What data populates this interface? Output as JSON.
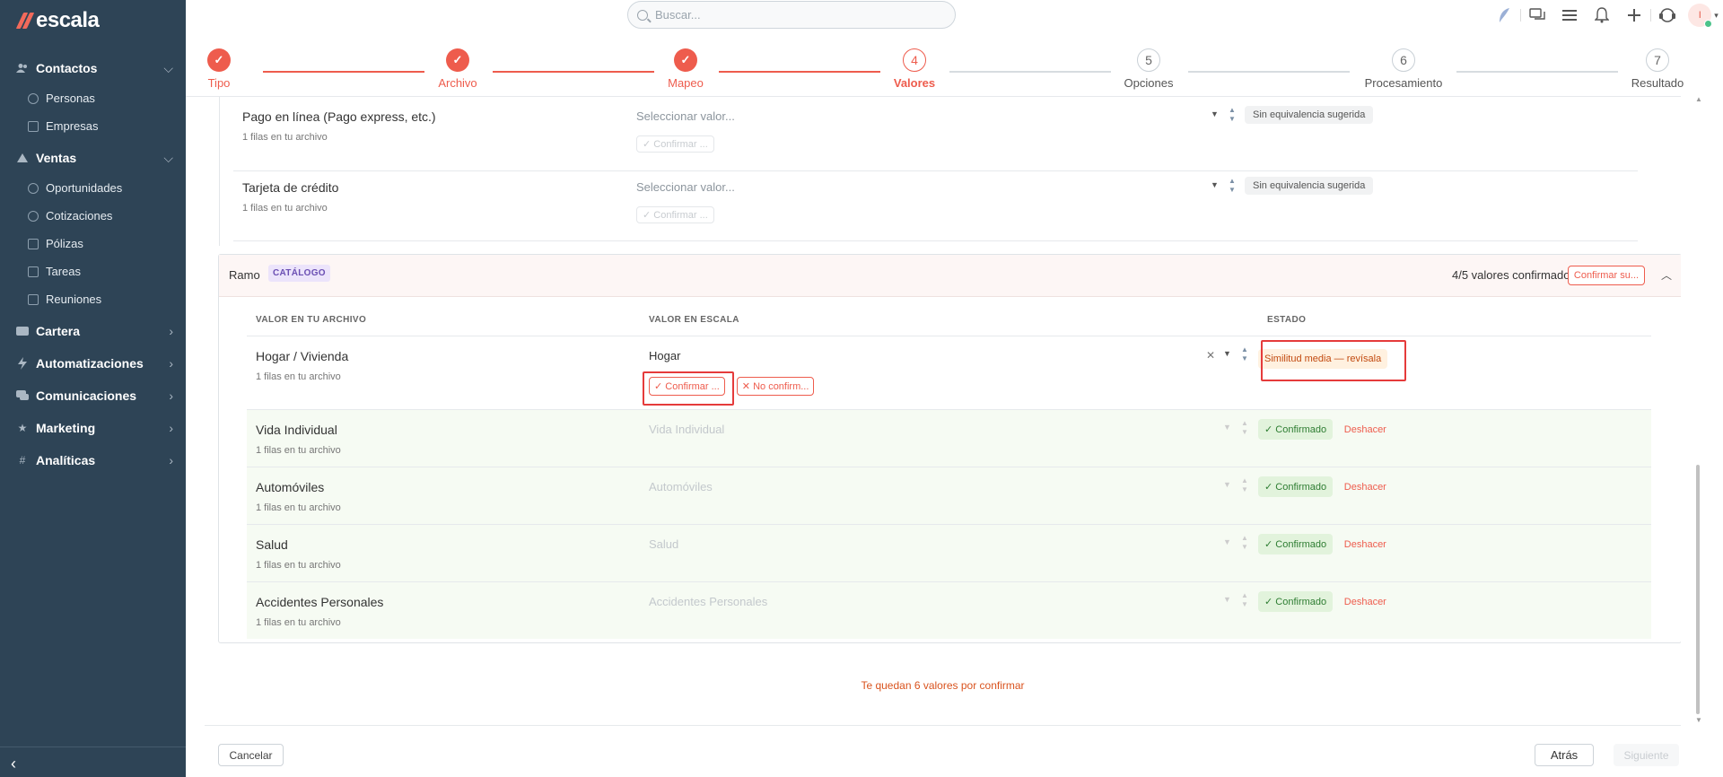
{
  "app": {
    "logo_text": "escala"
  },
  "sidebar": {
    "groups": [
      {
        "label": "Contactos",
        "icon": "users-icon",
        "expanded": true,
        "items": [
          "Personas",
          "Empresas"
        ]
      },
      {
        "label": "Ventas",
        "icon": "ventas-icon",
        "expanded": true,
        "items": [
          "Oportunidades",
          "Cotizaciones",
          "Pólizas",
          "Tareas",
          "Reuniones"
        ]
      },
      {
        "label": "Cartera",
        "icon": "wallet-icon",
        "expanded": false
      },
      {
        "label": "Automatizaciones",
        "icon": "bolt-icon",
        "expanded": false
      },
      {
        "label": "Comunicaciones",
        "icon": "chat-icon",
        "expanded": false
      },
      {
        "label": "Marketing",
        "icon": "star-icon",
        "expanded": false
      },
      {
        "label": "Analíticas",
        "icon": "hash-icon",
        "expanded": false
      }
    ]
  },
  "topbar": {
    "search_placeholder": "Buscar...",
    "avatar_initial": "I"
  },
  "stepper": {
    "steps": [
      {
        "num": "✓",
        "label": "Tipo",
        "state": "done"
      },
      {
        "num": "✓",
        "label": "Archivo",
        "state": "done"
      },
      {
        "num": "✓",
        "label": "Mapeo",
        "state": "done"
      },
      {
        "num": "4",
        "label": "Valores",
        "state": "active"
      },
      {
        "num": "5",
        "label": "Opciones",
        "state": "pending"
      },
      {
        "num": "6",
        "label": "Procesamiento",
        "state": "pending"
      },
      {
        "num": "7",
        "label": "Resultado",
        "state": "pending"
      }
    ]
  },
  "upper_rows": [
    {
      "name": "Pago en línea (Pago express, etc.)",
      "sub": "1 filas en tu archivo",
      "select_placeholder": "Seleccionar valor...",
      "confirm_chip": "✓ Confirmar ...",
      "status": "Sin equivalencia sugerida"
    },
    {
      "name": "Tarjeta de crédito",
      "sub": "1 filas en tu archivo",
      "select_placeholder": "Seleccionar valor...",
      "confirm_chip": "✓ Confirmar ...",
      "status": "Sin equivalencia sugerida"
    }
  ],
  "ramo": {
    "title": "Ramo",
    "tag": "CATÁLOGO",
    "count_text": "4/5 valores confirmados",
    "confirm_all_label": "Confirmar su...",
    "columns": {
      "file": "VALOR EN TU ARCHIVO",
      "escala": "VALOR EN ESCALA",
      "status": "ESTADO"
    },
    "rows": [
      {
        "name": "Hogar / Vivienda",
        "sub": "1 filas en tu archivo",
        "value": "Hogar",
        "confirm_label": "✓ Confirmar ...",
        "reject_label": "✕ No confirm...",
        "status": "Similitud media — revísala",
        "state": "pending"
      },
      {
        "name": "Vida Individual",
        "sub": "1 filas en tu archivo",
        "value": "Vida Individual",
        "status": "✓ Confirmado",
        "undo": "Deshacer",
        "state": "confirmed"
      },
      {
        "name": "Automóviles",
        "sub": "1 filas en tu archivo",
        "value": "Automóviles",
        "status": "✓ Confirmado",
        "undo": "Deshacer",
        "state": "confirmed"
      },
      {
        "name": "Salud",
        "sub": "1 filas en tu archivo",
        "value": "Salud",
        "status": "✓ Confirmado",
        "undo": "Deshacer",
        "state": "confirmed"
      },
      {
        "name": "Accidentes Personales",
        "sub": "1 filas en tu archivo",
        "value": "Accidentes Personales",
        "status": "✓ Confirmado",
        "undo": "Deshacer",
        "state": "confirmed"
      }
    ]
  },
  "remaining_text": "Te quedan 6 valores por confirmar",
  "footer": {
    "cancel": "Cancelar",
    "back": "Atrás",
    "next": "Siguiente"
  },
  "colors": {
    "sidebar": "#2e4456",
    "accent": "#ee5c4d",
    "confirmed": "#2e7d32",
    "warning": "#c24a10"
  }
}
